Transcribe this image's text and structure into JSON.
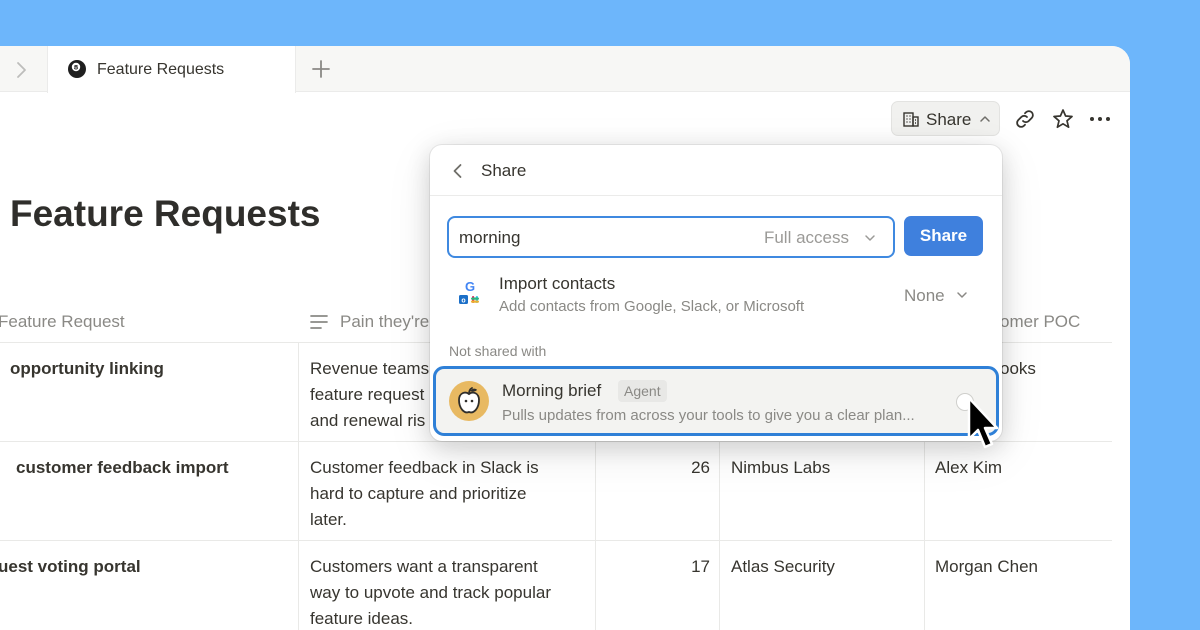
{
  "tabbar": {
    "tab_title": "Feature Requests",
    "tab_icon": "eight-ball-icon",
    "add_tab_icon": "plus-icon",
    "back_icon": "chevron-right-icon"
  },
  "topbar": {
    "share_label": "Share",
    "share_icon": "building-icon",
    "copy_link_icon": "link-icon",
    "favorite_icon": "star-icon",
    "more_icon": "ellipsis-icon"
  },
  "page": {
    "title": "Feature Requests"
  },
  "table": {
    "columns": [
      "Feature Request",
      "Pain they're",
      "omer POC"
    ],
    "rows": [
      {
        "feature": "opportunity linking",
        "pain": [
          "Revenue teams",
          "feature request",
          "and renewal ris"
        ],
        "count": "",
        "company": "",
        "poc": "ooks"
      },
      {
        "feature": "customer feedback import",
        "pain": [
          "Customer feedback in Slack is",
          "hard to capture and prioritize",
          "later."
        ],
        "count": "26",
        "company": "Nimbus Labs",
        "poc": "Alex Kim"
      },
      {
        "feature": "uest voting portal",
        "pain": [
          "Customers want a transparent",
          "way to upvote and track popular",
          "feature ideas."
        ],
        "count": "17",
        "company": "Atlas Security",
        "poc": "Morgan Chen"
      }
    ]
  },
  "share_popover": {
    "title": "Share",
    "search_value": "morning",
    "access_level": "Full access",
    "share_button": "Share",
    "import": {
      "title": "Import contacts",
      "subtitle": "Add contacts from Google, Slack, or Microsoft",
      "permission": "None"
    },
    "section_label": "Not shared with",
    "result": {
      "name": "Morning brief",
      "badge": "Agent",
      "description": "Pulls updates from across your tools to give you a clear plan..."
    }
  },
  "colors": {
    "background": "#6db6fb",
    "accent": "#3f80dd",
    "focus_ring": "#2f80d7",
    "avatar": "#e8b962"
  }
}
